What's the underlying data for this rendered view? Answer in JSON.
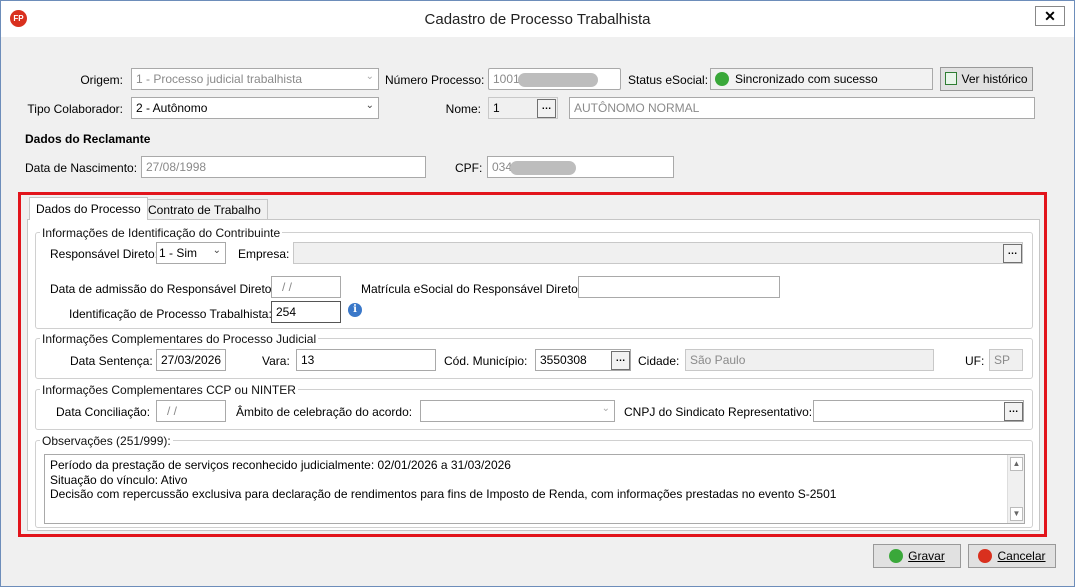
{
  "window": {
    "title": "Cadastro de Processo Trabalhista",
    "app_icon": "FP",
    "close_label": "✕"
  },
  "header": {
    "origem_label": "Origem:",
    "origem_value": "1 - Processo judicial trabalhista",
    "numero_label": "Número Processo:",
    "numero_value": "1001",
    "status_label": "Status eSocial:",
    "status_value": "Sincronizado com sucesso",
    "historico_label": "Ver histórico",
    "tipo_label": "Tipo Colaborador:",
    "tipo_value": "2 - Autônomo",
    "nome_label": "Nome:",
    "nome_code": "1",
    "nome_value": "AUTÔNOMO NORMAL"
  },
  "reclamante": {
    "section_title": "Dados do Reclamante",
    "nascimento_label": "Data de Nascimento:",
    "nascimento_value": "27/08/1998",
    "cpf_label": "CPF:",
    "cpf_value": "034"
  },
  "tabs": [
    {
      "label": "Dados do Processo",
      "active": true
    },
    {
      "label": "Contrato de Trabalho",
      "active": false
    }
  ],
  "contribuinte": {
    "group_title": "Informações de Identificação do Contribuinte",
    "responsavel_label": "Responsável Direto:",
    "responsavel_value": "1 - Sim",
    "empresa_label": "Empresa:",
    "empresa_value": "",
    "admissao_label": "Data de admissão do Responsável Direto:",
    "admissao_value": "/ /",
    "matricula_label": "Matrícula eSocial do Responsável Direto",
    "matricula_value": "",
    "identificacao_label": "Identificação de Processo Trabalhista:",
    "identificacao_value": "254"
  },
  "judicial": {
    "group_title": "Informações Complementares do Processo Judicial",
    "sentenca_label": "Data Sentença:",
    "sentenca_value": "27/03/2026",
    "vara_label": "Vara:",
    "vara_value": "13",
    "municipio_label": "Cód. Município:",
    "municipio_value": "3550308",
    "cidade_label": "Cidade:",
    "cidade_value": "São Paulo",
    "uf_label": "UF:",
    "uf_value": "SP"
  },
  "ccp": {
    "group_title": "Informações Complementares CCP ou NINTER",
    "conciliacao_label": "Data Conciliação:",
    "conciliacao_value": "/ /",
    "ambito_label": "Âmbito de celebração do acordo:",
    "ambito_value": "",
    "cnpj_label": "CNPJ do Sindicato Representativo:",
    "cnpj_value": ""
  },
  "observacoes": {
    "group_title": "Observações (251/999):",
    "lines": [
      "Período da prestação de serviços reconhecido judicialmente: 02/01/2026 a 31/03/2026",
      "Situação do vínculo: Ativo",
      "Decisão com repercussão exclusiva para declaração de rendimentos para fins de Imposto de Renda, com informações prestadas no evento S-2501"
    ]
  },
  "footer": {
    "gravar_label": "Gravar",
    "cancelar_label": "Cancelar"
  },
  "colors": {
    "highlight_border": "#e2141b",
    "status_ok": "#3aa83a",
    "cancel_red": "#d9301e"
  }
}
